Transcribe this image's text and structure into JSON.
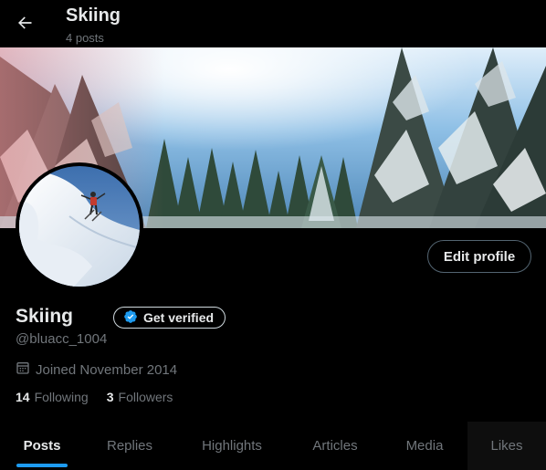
{
  "header": {
    "title": "Skiing",
    "post_count": "4 posts"
  },
  "profile": {
    "name": "Skiing",
    "handle": "@bluacc_1004",
    "verify_label": "Get verified",
    "joined": "Joined November 2014",
    "edit_label": "Edit profile",
    "following_count": "14",
    "following_label": "Following",
    "followers_count": "3",
    "followers_label": "Followers"
  },
  "tabs": [
    {
      "label": "Posts",
      "active": true
    },
    {
      "label": "Replies",
      "active": false
    },
    {
      "label": "Highlights",
      "active": false
    },
    {
      "label": "Articles",
      "active": false
    },
    {
      "label": "Media",
      "active": false
    },
    {
      "label": "Likes",
      "active": false
    }
  ],
  "colors": {
    "background": "#000000",
    "accent": "#1d9bf0",
    "text_primary": "#e7e9ea",
    "text_secondary": "#71767b"
  },
  "icons": {
    "back": "arrow-left-icon",
    "verified": "verified-badge-icon",
    "calendar": "calendar-icon"
  }
}
